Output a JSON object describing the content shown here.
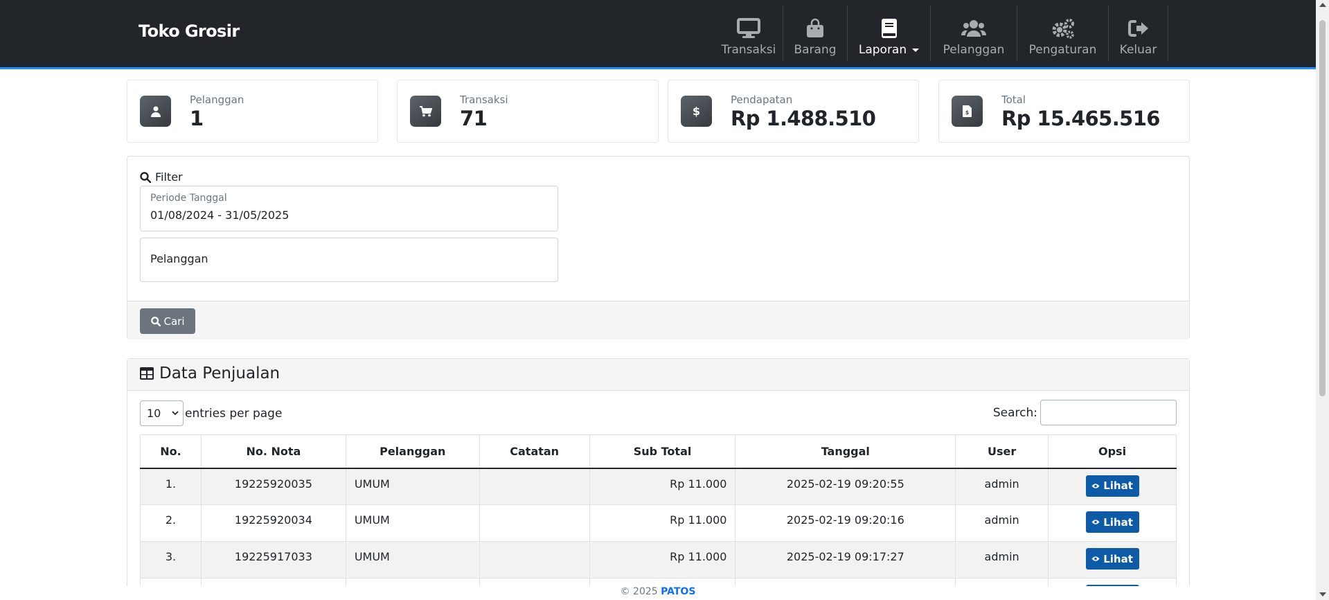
{
  "brand": "Toko Grosir",
  "nav": {
    "items": [
      {
        "label": "Transaksi",
        "icon": "desktop-icon"
      },
      {
        "label": "Barang",
        "icon": "shopping-bag-icon"
      },
      {
        "label": "Laporan",
        "icon": "book-icon",
        "active": true,
        "dropdown": true
      },
      {
        "label": "Pelanggan",
        "icon": "users-icon"
      },
      {
        "label": "Pengaturan",
        "icon": "gears-icon"
      },
      {
        "label": "Keluar",
        "icon": "sign-out-icon"
      }
    ]
  },
  "stats": [
    {
      "label": "Pelanggan",
      "value": "1",
      "icon": "user-icon"
    },
    {
      "label": "Transaksi",
      "value": "71",
      "icon": "cart-icon"
    },
    {
      "label": "Pendapatan",
      "value": "Rp 1.488.510",
      "icon": "dollar-icon"
    },
    {
      "label": "Total",
      "value": "Rp 15.465.516",
      "icon": "invoice-icon"
    }
  ],
  "filter": {
    "title": "Filter",
    "period_label": "Periode Tanggal",
    "period_value": "01/08/2024 - 31/05/2025",
    "customer_placeholder": "Pelanggan",
    "search_button": "Cari"
  },
  "table_section": {
    "title": "Data Penjualan",
    "entries_value": "10",
    "entries_label": "entries per page",
    "search_label": "Search:",
    "columns": [
      "No.",
      "No. Nota",
      "Pelanggan",
      "Catatan",
      "Sub Total",
      "Tanggal",
      "User",
      "Opsi"
    ],
    "rows": [
      {
        "no": "1.",
        "nota": "19225920035",
        "pelanggan": "UMUM",
        "catatan": "",
        "subtotal": "Rp 11.000",
        "tanggal": "2025-02-19 09:20:55",
        "user": "admin",
        "action": "Lihat"
      },
      {
        "no": "2.",
        "nota": "19225920034",
        "pelanggan": "UMUM",
        "catatan": "",
        "subtotal": "Rp 11.000",
        "tanggal": "2025-02-19 09:20:16",
        "user": "admin",
        "action": "Lihat"
      },
      {
        "no": "3.",
        "nota": "19225917033",
        "pelanggan": "UMUM",
        "catatan": "",
        "subtotal": "Rp 11.000",
        "tanggal": "2025-02-19 09:17:27",
        "user": "admin",
        "action": "Lihat"
      }
    ]
  },
  "footer": {
    "copyright": "© 2025",
    "brand": "PATOS"
  },
  "colors": {
    "navbar": "#22262a",
    "accent_line": "#1e90ff",
    "primary_button": "#0d5aa7",
    "secondary_button": "#6c757d",
    "link": "#0d6efd"
  }
}
